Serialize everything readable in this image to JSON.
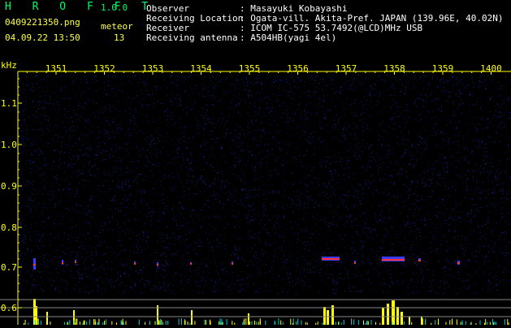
{
  "header": {
    "app_title": "H R O F F T",
    "version": "1.0.0",
    "filename": "0409221350.png",
    "datetime": "04.09.22 13:50",
    "meteor_label": "meteor",
    "meteor_count": "13",
    "fields": [
      {
        "label": "Observer",
        "value": ": Masayuki Kobayashi"
      },
      {
        "label": "Receiving Location",
        "value": ": Ogata-vill. Akita-Pref. JAPAN (139.96E, 40.02N)"
      },
      {
        "label": "Receiver",
        "value": ": ICOM IC-575 53.7492(@LCD)MHz USB"
      },
      {
        "label": "Receiving antenna",
        "value": ": A504HB(yagi 4el)"
      }
    ]
  },
  "spectrogram": {
    "y_unit": "kHz",
    "x_ticks": [
      "1351",
      "1352",
      "1353",
      "1354",
      "1355",
      "1356",
      "1357",
      "1358",
      "1359",
      "1400"
    ],
    "y_ticks": [
      "1.1",
      "1.0",
      "0.9",
      "0.8",
      "0.7",
      "0.6"
    ],
    "colors": {
      "background": "#000000",
      "noise": "#1a1a9a",
      "axis": "#ffff00",
      "bars": "#ffff00",
      "echo": "#ff3030"
    }
  }
}
